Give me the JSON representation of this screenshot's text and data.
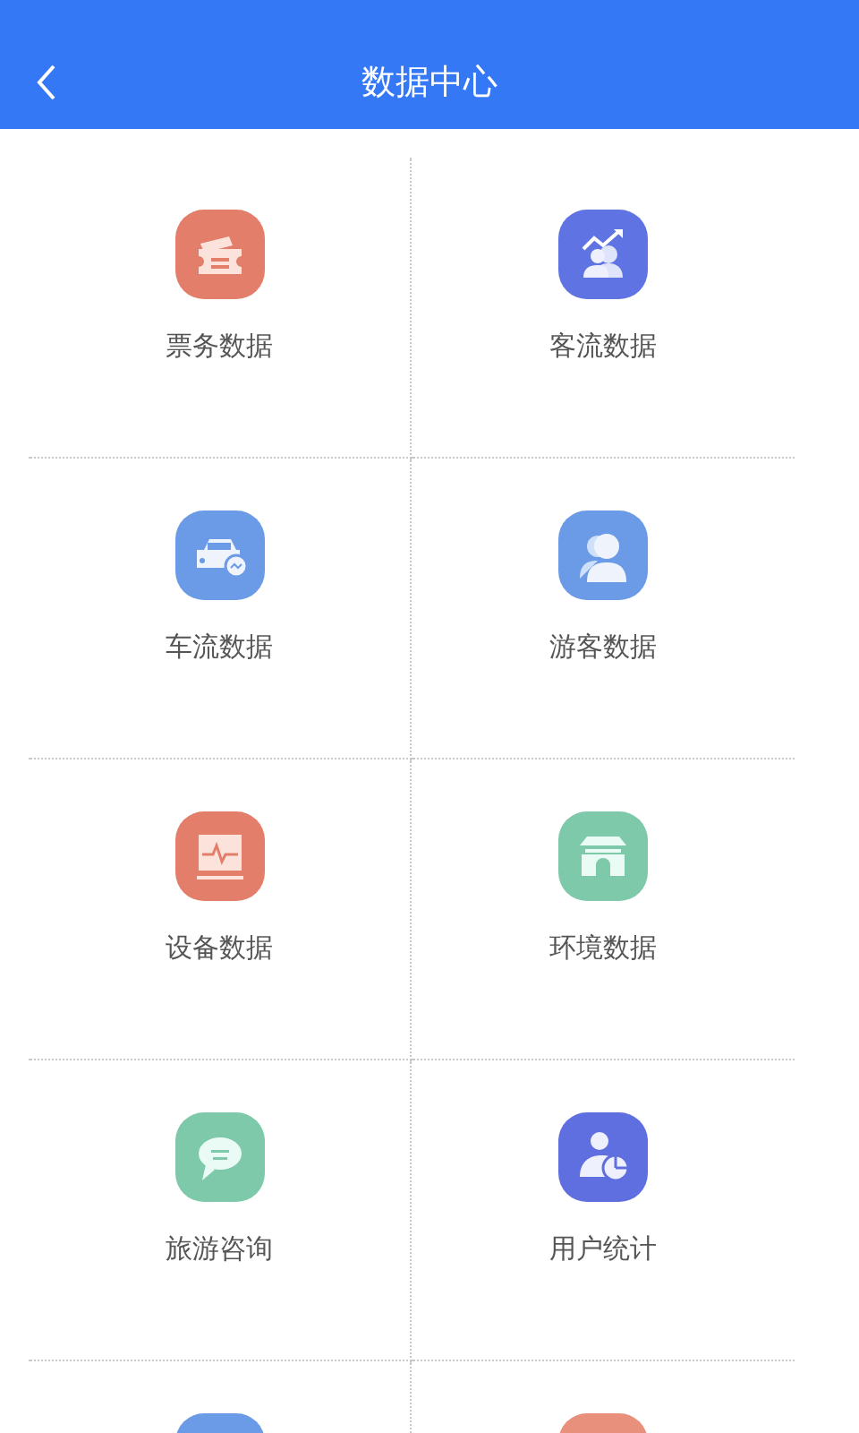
{
  "header": {
    "title": "数据中心"
  },
  "items": [
    {
      "label": "票务数据",
      "color": "#e37e6b"
    },
    {
      "label": "客流数据",
      "color": "#5f74e2"
    },
    {
      "label": "车流数据",
      "color": "#6b9be6"
    },
    {
      "label": "游客数据",
      "color": "#6b9be6"
    },
    {
      "label": "设备数据",
      "color": "#e37e6b"
    },
    {
      "label": "环境数据",
      "color": "#7ec9aa"
    },
    {
      "label": "旅游咨询",
      "color": "#7ec9aa"
    },
    {
      "label": "用户统计",
      "color": "#5f6fe0"
    },
    {
      "color": "#6b9be6"
    },
    {
      "color": "#e8907c"
    }
  ]
}
